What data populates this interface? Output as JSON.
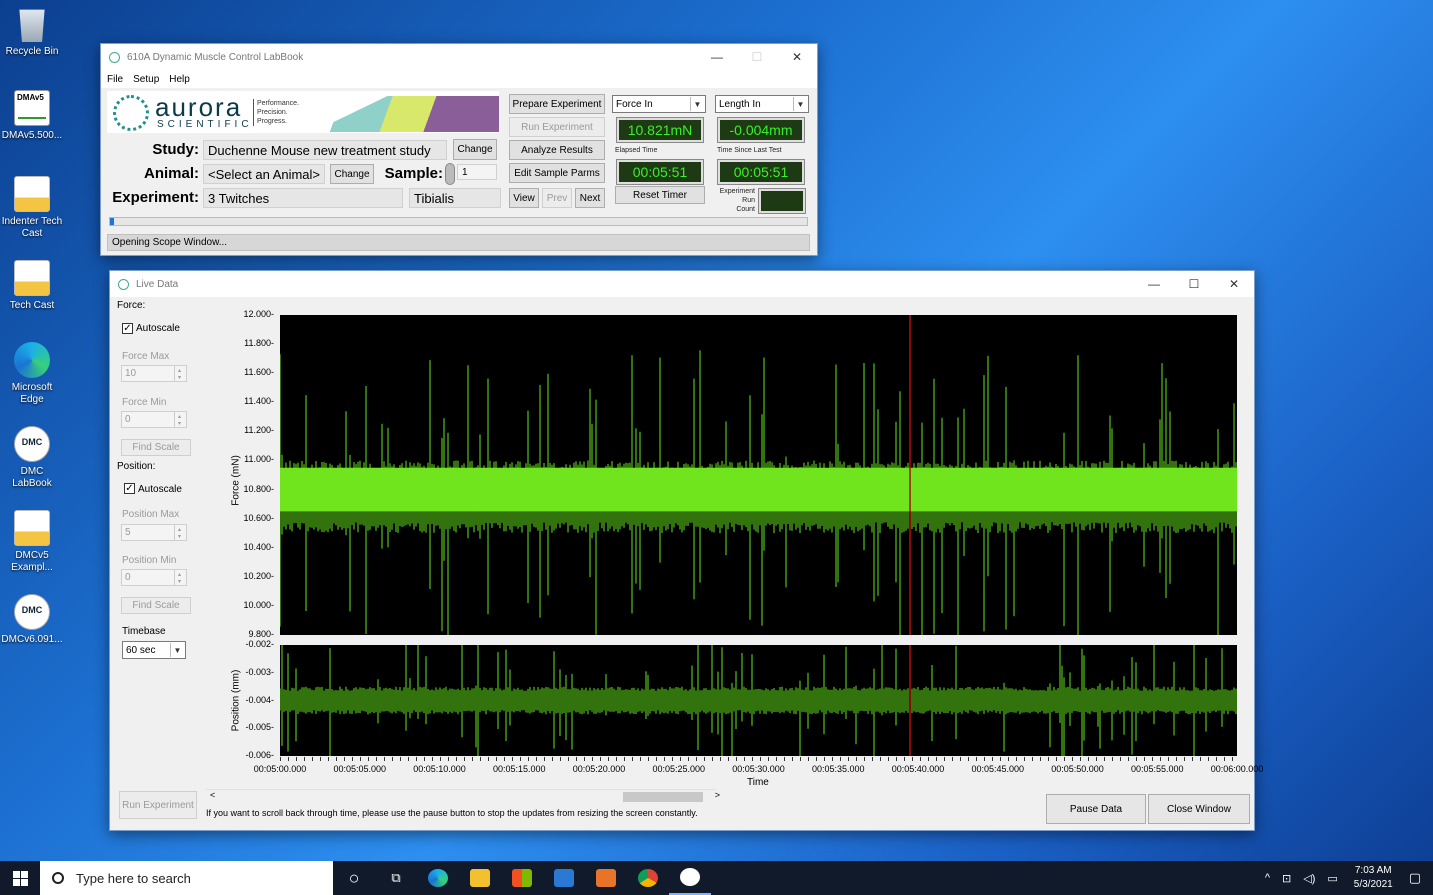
{
  "desktop": {
    "icons": [
      {
        "label": "Recycle Bin"
      },
      {
        "label": "DMAv5.500..."
      },
      {
        "label": "Indenter Tech Cast"
      },
      {
        "label": "Tech Cast"
      },
      {
        "label": "Microsoft Edge"
      },
      {
        "label": "DMC LabBook"
      },
      {
        "label": "DMCv5 Exampl..."
      },
      {
        "label": "DMCv6.091..."
      }
    ]
  },
  "labbook": {
    "title": "610A Dynamic Muscle Control LabBook",
    "menu": [
      "File",
      "Setup",
      "Help"
    ],
    "logo": {
      "word": "aurora",
      "sub": "SCIENTIFIC",
      "tagline1": "Performance.",
      "tagline2": "Precision.",
      "tagline3": "Progress."
    },
    "study_label": "Study:",
    "study_value": "Duchenne Mouse new treatment study",
    "animal_label": "Animal:",
    "animal_value": "<Select an Animal>",
    "sample_label": "Sample:",
    "sample_value": "1",
    "experiment_label": "Experiment:",
    "experiment_value": "3 Twitches",
    "muscle_value": "Tibialis",
    "change_label": "Change",
    "view_label": "View",
    "prev_label": "Prev",
    "next_label": "Next",
    "prepare_label": "Prepare Experiment",
    "run_label": "Run Experiment",
    "analyze_label": "Analyze Results",
    "edit_label": "Edit Sample Parms",
    "force_select": "Force In",
    "length_select": "Length In",
    "force_reading": "10.821mN",
    "length_reading": "-0.004mm",
    "elapsed_label": "Elapsed Time",
    "elapsed_value": "00:05:51",
    "since_label": "Time Since Last Test",
    "since_value": "00:05:51",
    "reset_label": "Reset Timer",
    "run_count_label_1": "Experiment",
    "run_count_label_2": "Run",
    "run_count_label_3": "Count",
    "status": "Opening Scope Window..."
  },
  "livedata": {
    "title": "Live Data",
    "force_heading": "Force:",
    "autoscale_label": "Autoscale",
    "force_max_label": "Force Max",
    "force_max_value": "10",
    "force_min_label": "Force Min",
    "force_min_value": "0",
    "find_scale_label": "Find Scale",
    "position_heading": "Position:",
    "position_max_label": "Position Max",
    "position_max_value": "5",
    "position_min_label": "Position Min",
    "position_min_value": "0",
    "timebase_label": "Timebase",
    "timebase_value": "60 sec",
    "run_experiment_label": "Run Experiment",
    "hint": "If you want to scroll back through time, please use the pause button to stop the updates from resizing the screen constantly.",
    "pause_label": "Pause Data",
    "close_label": "Close Window"
  },
  "chart_data": [
    {
      "type": "line",
      "ylabel": "Force (mN)",
      "xlabel": "Time",
      "ylim": [
        9.8,
        12.0
      ],
      "yticks": [
        "12.000",
        "11.800",
        "11.600",
        "11.400",
        "11.200",
        "11.000",
        "10.800",
        "10.600",
        "10.400",
        "10.200",
        "10.000",
        "9.800"
      ],
      "xticks": [
        "00:05:00.000",
        "00:05:05.000",
        "00:05:10.000",
        "00:05:15.000",
        "00:05:20.000",
        "00:05:25.000",
        "00:05:30.000",
        "00:05:35.000",
        "00:05:40.000",
        "00:05:45.000",
        "00:05:50.000",
        "00:05:55.000",
        "00:06:00.000"
      ],
      "band": {
        "low": 10.5,
        "high": 11.0,
        "dense_low": 10.65,
        "dense_high": 10.95
      },
      "cursor_x": "00:05:39.500",
      "grid": false
    },
    {
      "type": "line",
      "ylabel": "Position (mm)",
      "ylim": [
        -0.006,
        -0.002
      ],
      "yticks": [
        "-0.002",
        "-0.003",
        "-0.004",
        "-0.005",
        "-0.006"
      ],
      "band": {
        "low": -0.0045,
        "high": -0.0035
      },
      "cursor_x": "00:05:39.500",
      "grid": false
    }
  ],
  "taskbar": {
    "search_placeholder": "Type here to search",
    "time": "7:03 AM",
    "date": "5/3/2021"
  }
}
